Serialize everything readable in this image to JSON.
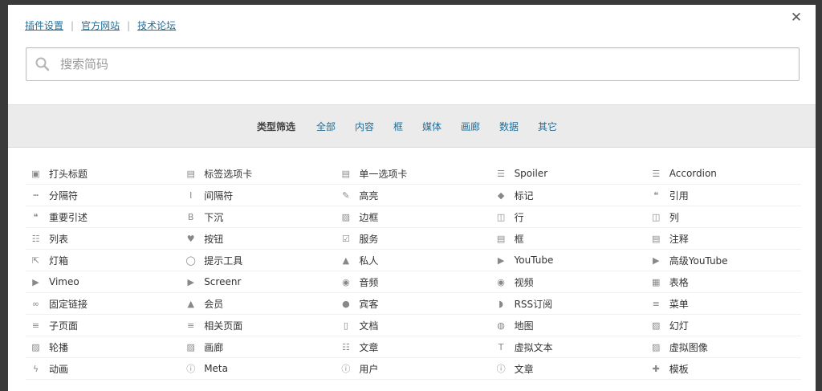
{
  "top_links": [
    "插件设置",
    "官方网站",
    "技术论坛"
  ],
  "search": {
    "placeholder": "搜索简码"
  },
  "filter": {
    "label": "类型筛选",
    "items": [
      "全部",
      "内容",
      "框",
      "媒体",
      "画廊",
      "数据",
      "其它"
    ]
  },
  "shortcodes": [
    {
      "label": "打头标题",
      "icon": "heading-icon"
    },
    {
      "label": "标签选项卡",
      "icon": "list-alt-icon"
    },
    {
      "label": "单一选项卡",
      "icon": "list-alt-icon"
    },
    {
      "label": "Spoiler",
      "icon": "list-icon"
    },
    {
      "label": "Accordion",
      "icon": "list-icon"
    },
    {
      "label": "分隔符",
      "icon": "ellipsis-icon"
    },
    {
      "label": "间隔符",
      "icon": "text-cursor-icon"
    },
    {
      "label": "高亮",
      "icon": "pencil-icon"
    },
    {
      "label": "标记",
      "icon": "tag-icon"
    },
    {
      "label": "引用",
      "icon": "quote-icon"
    },
    {
      "label": "重要引述",
      "icon": "quote-icon"
    },
    {
      "label": "下沉",
      "icon": "bold-icon"
    },
    {
      "label": "边框",
      "icon": "image-icon"
    },
    {
      "label": "行",
      "icon": "columns-icon"
    },
    {
      "label": "列",
      "icon": "columns-icon"
    },
    {
      "label": "列表",
      "icon": "list-ol-icon"
    },
    {
      "label": "按钮",
      "icon": "heart-icon"
    },
    {
      "label": "服务",
      "icon": "check-square-icon"
    },
    {
      "label": "框",
      "icon": "list-alt-icon"
    },
    {
      "label": "注释",
      "icon": "list-alt-icon"
    },
    {
      "label": "灯箱",
      "icon": "external-link-icon"
    },
    {
      "label": "提示工具",
      "icon": "comment-icon"
    },
    {
      "label": "私人",
      "icon": "lock-icon"
    },
    {
      "label": "YouTube",
      "icon": "play-icon"
    },
    {
      "label": "高级YouTube",
      "icon": "play-icon"
    },
    {
      "label": "Vimeo",
      "icon": "play-icon"
    },
    {
      "label": "Screenr",
      "icon": "play-icon"
    },
    {
      "label": "音频",
      "icon": "play-circle-icon"
    },
    {
      "label": "视频",
      "icon": "play-circle-icon"
    },
    {
      "label": "表格",
      "icon": "table-icon"
    },
    {
      "label": "固定链接",
      "icon": "link-icon"
    },
    {
      "label": "会员",
      "icon": "lock-icon"
    },
    {
      "label": "宾客",
      "icon": "user-icon"
    },
    {
      "label": "RSS订阅",
      "icon": "rss-icon"
    },
    {
      "label": "菜单",
      "icon": "bars-icon"
    },
    {
      "label": "子页面",
      "icon": "bars-icon"
    },
    {
      "label": "相关页面",
      "icon": "bars-icon"
    },
    {
      "label": "文档",
      "icon": "file-icon"
    },
    {
      "label": "地图",
      "icon": "globe-icon"
    },
    {
      "label": "幻灯",
      "icon": "image-icon"
    },
    {
      "label": "轮播",
      "icon": "image-icon"
    },
    {
      "label": "画廊",
      "icon": "image-icon"
    },
    {
      "label": "文章",
      "icon": "th-list-icon"
    },
    {
      "label": "虚拟文本",
      "icon": "text-height-icon"
    },
    {
      "label": "虚拟图像",
      "icon": "image-icon"
    },
    {
      "label": "动画",
      "icon": "bolt-icon"
    },
    {
      "label": "Meta",
      "icon": "info-icon"
    },
    {
      "label": "用户",
      "icon": "info-icon"
    },
    {
      "label": "文章",
      "icon": "info-icon"
    },
    {
      "label": "模板",
      "icon": "puzzle-icon"
    }
  ]
}
